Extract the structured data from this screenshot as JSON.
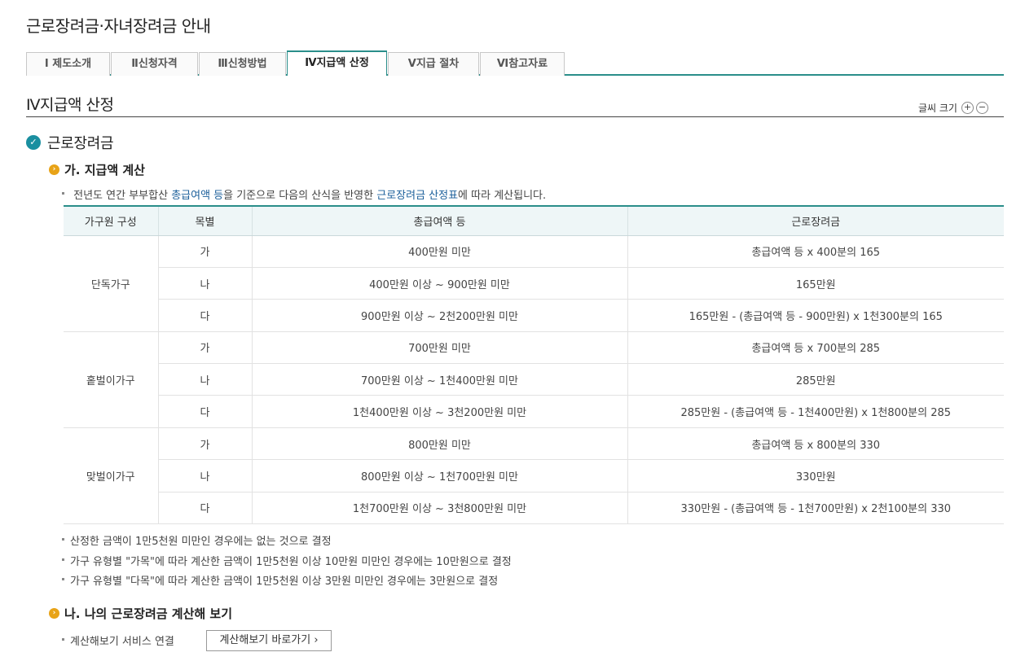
{
  "page_title": "근로장려금·자녀장려금 안내",
  "tabs": [
    {
      "label": "Ⅰ 제도소개"
    },
    {
      "label": "Ⅱ신청자격"
    },
    {
      "label": "Ⅲ신청방법"
    },
    {
      "label": "Ⅳ지급액 산정"
    },
    {
      "label": "Ⅴ지급 절차"
    },
    {
      "label": "Ⅵ참고자료"
    }
  ],
  "active_tab": "Ⅳ지급액 산정",
  "section_title": "Ⅳ지급액 산정",
  "font_size_control": {
    "label": "글씨 크기",
    "plus": "+",
    "minus": "−"
  },
  "heading": "근로장려금",
  "sub_a": {
    "title": "가. 지급액 계산",
    "intro_prefix": "전년도 연간 부부합산 ",
    "intro_link1": "총급여액 등",
    "intro_mid": "을 기준으로 다음의 산식을 반영한 ",
    "intro_link2": "근로장려금 산정표",
    "intro_suffix": "에 따라 계산됩니다."
  },
  "table": {
    "headers": [
      "가구원 구성",
      "목별",
      "총급여액 등",
      "근로장려금"
    ],
    "groups": [
      {
        "name": "단독가구",
        "rows": [
          {
            "grade": "가",
            "income": "400만원 미만",
            "amount": "총급여액 등 x 400분의 165"
          },
          {
            "grade": "나",
            "income": "400만원 이상 ~ 900만원 미만",
            "amount": "165만원"
          },
          {
            "grade": "다",
            "income": "900만원 이상 ~ 2천200만원 미만",
            "amount": "165만원 - (총급여액 등 - 900만원) x 1천300분의 165"
          }
        ]
      },
      {
        "name": "홑벌이가구",
        "rows": [
          {
            "grade": "가",
            "income": "700만원 미만",
            "amount": "총급여액 등 x 700분의 285"
          },
          {
            "grade": "나",
            "income": "700만원 이상 ~ 1천400만원 미만",
            "amount": "285만원"
          },
          {
            "grade": "다",
            "income": "1천400만원 이상 ~ 3천200만원 미만",
            "amount": "285만원 - (총급여액 등 - 1천400만원) x 1천800분의 285"
          }
        ]
      },
      {
        "name": "맞벌이가구",
        "rows": [
          {
            "grade": "가",
            "income": "800만원 미만",
            "amount": "총급여액 등 x 800분의 330"
          },
          {
            "grade": "나",
            "income": "800만원 이상 ~ 1천700만원 미만",
            "amount": "330만원"
          },
          {
            "grade": "다",
            "income": "1천700만원 이상 ~ 3천800만원 미만",
            "amount": "330만원 - (총급여액 등 - 1천700만원) x 2천100분의 330"
          }
        ]
      }
    ]
  },
  "notes": [
    "산정한 금액이 1만5천원 미만인 경우에는 없는 것으로 결정",
    "가구 유형별 \"가목\"에 따라 계산한 금액이 1만5천원 이상 10만원 미만인 경우에는 10만원으로 결정",
    "가구 유형별 \"다목\"에 따라 계산한 금액이 1만5천원 이상 3만원 미만인 경우에는 3만원으로 결정"
  ],
  "sub_b": {
    "title": "나. 나의 근로장려금 계산해 보기",
    "service_label": "계산해보기 서비스 연결",
    "button_label": "계산해보기 바로가기 ›"
  },
  "colors": {
    "accent": "#2a8e8a",
    "check": "#1a8fa0",
    "arrow": "#e8a317",
    "link": "#1a5e9a"
  }
}
